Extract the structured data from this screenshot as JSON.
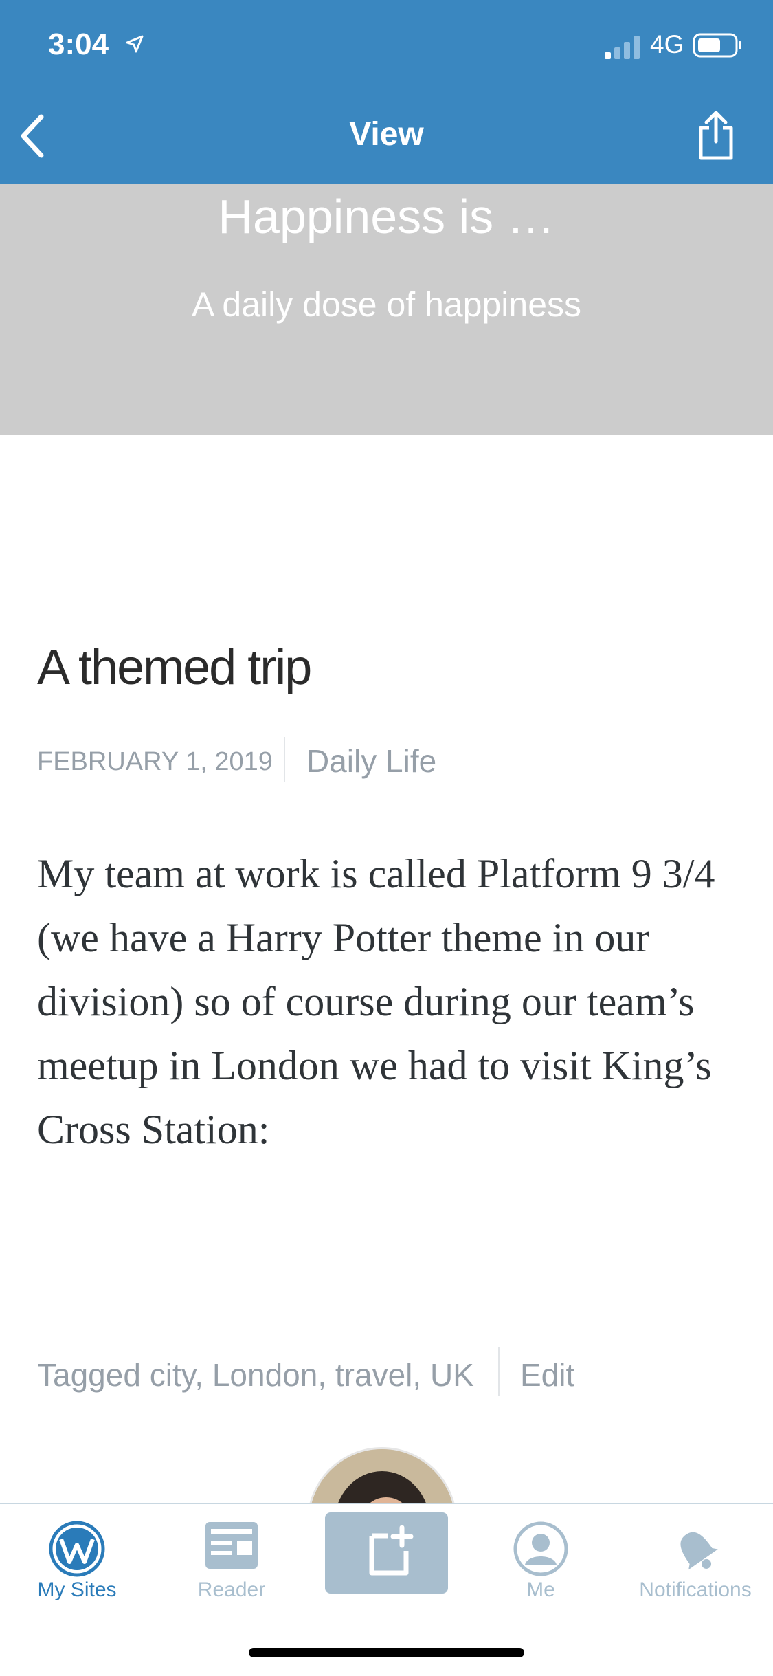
{
  "status_bar": {
    "time": "3:04",
    "network": "4G"
  },
  "nav": {
    "title": "View"
  },
  "site": {
    "title": "Happiness is …",
    "tagline": "A daily dose of happiness"
  },
  "post": {
    "title": "A themed trip",
    "date": "FEBRUARY 1, 2019",
    "category": "Daily Life",
    "body": "My team at work is called Platform 9 3/4 (we have a Harry Potter theme in our division) so of course during our team’s meetup in London we had to visit King’s Cross Station:",
    "tags_line": "Tagged city, London, travel, UK",
    "edit_label": "Edit"
  },
  "tabs": [
    {
      "label": "My Sites",
      "icon": "wordpress-icon"
    },
    {
      "label": "Reader",
      "icon": "reader-icon"
    },
    {
      "label": "",
      "icon": "new-post-icon"
    },
    {
      "label": "Me",
      "icon": "me-icon"
    },
    {
      "label": "Notifications",
      "icon": "bell-icon"
    }
  ],
  "colors": {
    "accent": "#3a87c0",
    "tab_active": "#2a7bb9",
    "tab_inactive": "#a8bece",
    "header_bg": "#cccccc"
  }
}
